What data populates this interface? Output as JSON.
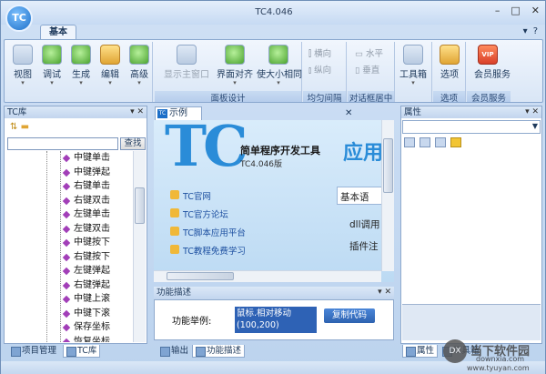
{
  "window": {
    "title": "TC4.046",
    "logo": "TC",
    "minimize": "–",
    "maximize": "□",
    "close": "✕"
  },
  "ribbon_tab": "基本",
  "ribbon": {
    "group_panel_design": "面板设计",
    "group_spacing": "均匀间隔",
    "group_dialog_center": "对话框居中",
    "group_options": "选项",
    "group_member": "会员服务",
    "btn_view": "视图",
    "btn_debug": "调试",
    "btn_build": "生成",
    "btn_edit": "编辑",
    "btn_advanced": "高级",
    "btn_show_main": "显示主窗口",
    "btn_align": "界面对齐",
    "btn_same_size": "使大小相同",
    "btn_horizontal_dir": "横向",
    "btn_vertical_dir": "纵向",
    "btn_horizontal": "水平",
    "btn_vertical": "垂直",
    "btn_toolbox": "工具箱",
    "btn_options": "选项",
    "btn_member": "会员服务",
    "vip": "VIP"
  },
  "left_panel": {
    "title": "TC库",
    "search_button": "查找",
    "search_value": "",
    "items": [
      "中键单击",
      "中键弹起",
      "右键单击",
      "右键双击",
      "左键单击",
      "左键双击",
      "中键按下",
      "右键按下",
      "左键弹起",
      "右键弹起",
      "中键上滚",
      "中键下滚",
      "保存坐标",
      "恢复坐标"
    ],
    "tab_project": "项目管理",
    "tab_library": "TC库"
  },
  "doc": {
    "tab": "示例",
    "heading": "简单程序开发工具",
    "version": "TC4.046版",
    "big": "TC",
    "app_word": "应用",
    "links": [
      "TC官网",
      "TC官方论坛",
      "TC脚本应用平台",
      "TC教程免费学习"
    ],
    "side_box": "基本语",
    "side_1": "dll调用",
    "side_2": "插件注"
  },
  "func": {
    "title": "功能描述",
    "label": "功能举例:",
    "value_line1": "鼠标.相对移动",
    "value_line2": "(100,200)",
    "copy_button": "复制代码"
  },
  "bottom_tabs": {
    "output": "输出",
    "func_desc": "功能描述"
  },
  "right_panel": {
    "title": "属性",
    "tab_props": "属性",
    "tab_toolbox": "工具箱"
  },
  "watermark": {
    "name": "当下软件园",
    "site1": "downxia.com",
    "site2": "www.tyuyan.com",
    "logo": "DX"
  }
}
